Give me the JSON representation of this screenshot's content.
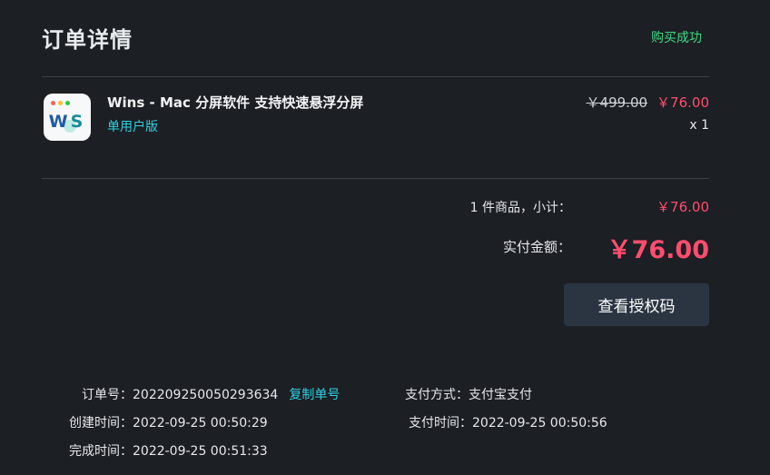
{
  "header": {
    "title": "订单详情",
    "status": "购买成功"
  },
  "product": {
    "icon_name": "wins-app-icon",
    "icon_text_w": "W",
    "icon_text_s": "S",
    "name": "Wins - Mac 分屏软件 支持快速悬浮分屏",
    "edition": "单用户版",
    "original_price": "￥499.00",
    "price": "￥76.00",
    "quantity": "x 1"
  },
  "summary": {
    "subtotal_label": "1 件商品，小计：",
    "subtotal_value": "￥76.00",
    "paid_label": "实付金额：",
    "paid_value": "￥76.00",
    "license_button": "查看授权码"
  },
  "order_info": {
    "order_no_label": "订单号：",
    "order_no": "202209250050293634",
    "copy_label": "复制单号",
    "created_label": "创建时间：",
    "created": "2022-09-25 00:50:29",
    "completed_label": "完成时间：",
    "completed": "2022-09-25 00:51:33",
    "pay_method_label": "支付方式：",
    "pay_method": "支付宝支付",
    "pay_time_label": "支付时间：",
    "pay_time": "2022-09-25 00:50:56"
  },
  "colors": {
    "background": "#1c1f24",
    "success": "#3ddc84",
    "price": "#ff4d6d",
    "link": "#2fd0e0",
    "button": "#2b3542"
  }
}
